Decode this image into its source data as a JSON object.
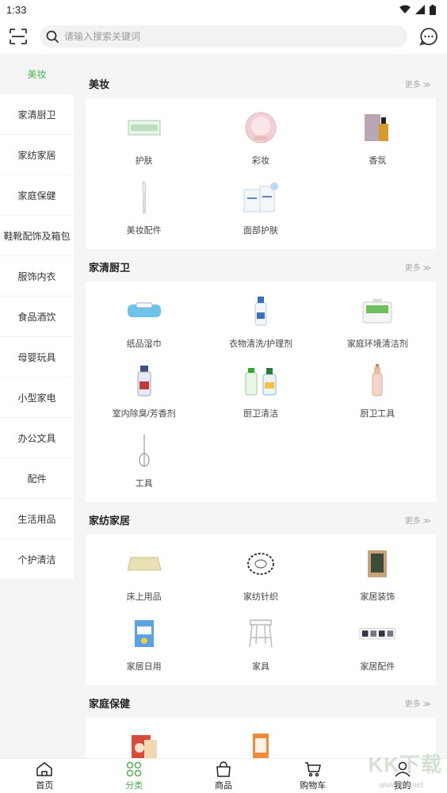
{
  "status": {
    "time": "1:33"
  },
  "search": {
    "placeholder": "请输入搜索关键词"
  },
  "sidebar": {
    "items": [
      {
        "label": "美妆"
      },
      {
        "label": "家清厨卫"
      },
      {
        "label": "家纺家居"
      },
      {
        "label": "家庭保健"
      },
      {
        "label": "鞋靴配饰及箱包"
      },
      {
        "label": "服饰内衣"
      },
      {
        "label": "食品酒饮"
      },
      {
        "label": "母婴玩具"
      },
      {
        "label": "小型家电"
      },
      {
        "label": "办公文具"
      },
      {
        "label": "配件"
      },
      {
        "label": "生活用品"
      },
      {
        "label": "个护清洁"
      }
    ]
  },
  "sections": [
    {
      "title": "美妆",
      "more": "更多 ≫",
      "items": [
        {
          "label": "护肤",
          "icon": "skincare-box-icon"
        },
        {
          "label": "彩妆",
          "icon": "cushion-compact-icon"
        },
        {
          "label": "香氛",
          "icon": "perfume-icon"
        },
        {
          "label": "美妆配件",
          "icon": "makeup-brush-icon"
        },
        {
          "label": "面部护肤",
          "icon": "face-care-set-icon"
        }
      ]
    },
    {
      "title": "家清厨卫",
      "more": "更多 ≫",
      "items": [
        {
          "label": "纸品湿巾",
          "icon": "wet-wipes-icon"
        },
        {
          "label": "衣物清洗/护理剂",
          "icon": "detergent-bottle-icon"
        },
        {
          "label": "家庭环境清洁剂",
          "icon": "cleaner-tub-icon"
        },
        {
          "label": "室内除臭/芳香剂",
          "icon": "air-freshener-icon"
        },
        {
          "label": "厨卫清洁",
          "icon": "kitchen-cleaner-icon"
        },
        {
          "label": "厨卫工具",
          "icon": "kitchen-tool-icon"
        },
        {
          "label": "工具",
          "icon": "whisk-icon"
        }
      ]
    },
    {
      "title": "家纺家居",
      "more": "更多 ≫",
      "items": [
        {
          "label": "床上用品",
          "icon": "mat-icon"
        },
        {
          "label": "家纺针织",
          "icon": "scarf-icon"
        },
        {
          "label": "家居装饰",
          "icon": "frame-decor-icon"
        },
        {
          "label": "家居日用",
          "icon": "daily-goods-icon"
        },
        {
          "label": "家具",
          "icon": "stool-icon"
        },
        {
          "label": "家居配件",
          "icon": "hooks-icon"
        }
      ]
    },
    {
      "title": "家庭保健",
      "more": "更多 ≫",
      "items": [
        {
          "label": "",
          "icon": "health-snack-icon"
        },
        {
          "label": "",
          "icon": "health-pack-icon"
        }
      ]
    }
  ],
  "bottom_nav": [
    {
      "label": "首页",
      "icon": "home-icon"
    },
    {
      "label": "分类",
      "icon": "category-icon"
    },
    {
      "label": "商品",
      "icon": "bag-icon"
    },
    {
      "label": "购物车",
      "icon": "cart-icon"
    },
    {
      "label": "我的",
      "icon": "user-icon"
    }
  ],
  "watermark": {
    "text": "KK下载",
    "url": "www.kkx.net"
  },
  "colors": {
    "accent": "#4caf50",
    "background": "#f5f5f5"
  }
}
